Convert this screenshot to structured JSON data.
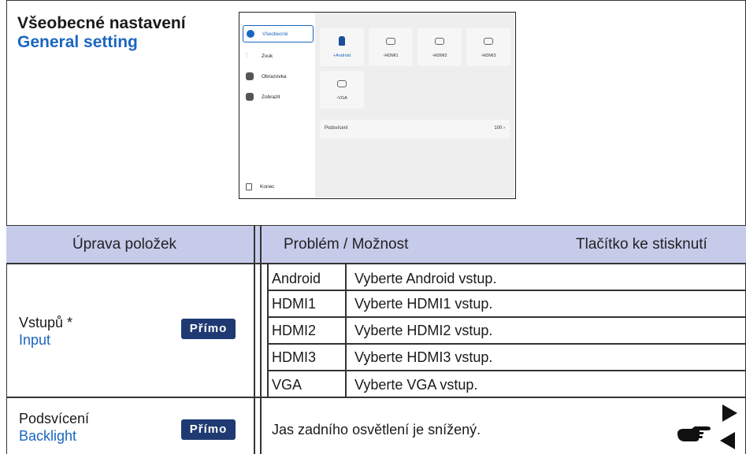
{
  "section": {
    "title_cz": "Všeobecné nastavení",
    "title_en": "General setting"
  },
  "screenshot": {
    "sidebar": [
      {
        "label": "Všeobecné",
        "icon": "settings-icon",
        "active": true
      },
      {
        "label": "Zvuk",
        "icon": "equalizer-icon",
        "active": false
      },
      {
        "label": "Obrazovka",
        "icon": "screen-icon",
        "active": false
      },
      {
        "label": "Zobrazit",
        "icon": "display-icon",
        "active": false
      }
    ],
    "exit_label": "Konec",
    "inputs": [
      {
        "label": "+Android",
        "icon": "android-icon"
      },
      {
        "label": "◦HDMI1",
        "icon": "hdmi-icon"
      },
      {
        "label": "◦HDMI2",
        "icon": "hdmi-icon"
      },
      {
        "label": "◦HDMI3",
        "icon": "hdmi-icon"
      },
      {
        "label": "◦VGA",
        "icon": "vga-icon"
      }
    ],
    "backlight_label": "Podsvícení",
    "backlight_value": "100 ›"
  },
  "table": {
    "headers": {
      "item": "Úprava položek",
      "problem": "Problém / Možnost",
      "button": "Tlačítko ke stisknutí"
    },
    "input_row": {
      "label_cz": "Vstupů *",
      "label_en": "Input",
      "badge": "Přímo",
      "options": [
        {
          "name": "Android",
          "desc": "Vyberte Android vstup."
        },
        {
          "name": "HDMI1",
          "desc": "Vyberte HDMI1 vstup."
        },
        {
          "name": "HDMI2",
          "desc": "Vyberte HDMI2 vstup."
        },
        {
          "name": "HDMI3",
          "desc": "Vyberte HDMI3 vstup."
        },
        {
          "name": "VGA",
          "desc": "Vyberte VGA vstup."
        }
      ]
    },
    "backlight_row": {
      "label_cz": "Podsvícení",
      "label_en": "Backlight",
      "badge": "Přímo",
      "desc": "Jas zadního osvětlení je snížený."
    }
  },
  "colors": {
    "header_bg": "#c7cbea",
    "accent_blue": "#1a66c0",
    "badge_bg": "#1f3a72"
  }
}
